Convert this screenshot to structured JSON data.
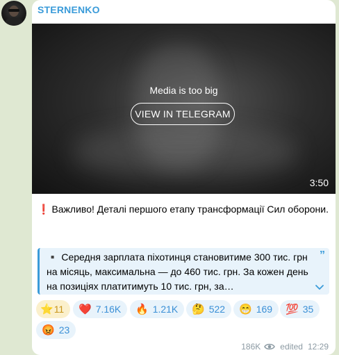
{
  "channel": {
    "name": "STERNENKO"
  },
  "media": {
    "message": "Media is too big",
    "button_label": "VIEW IN TELEGRAM",
    "duration": "3:50"
  },
  "post": {
    "headline_icon": "❗",
    "headline": "Важливо! Деталі першого етапу трансформації Сил оборони.",
    "quote_icon": "▪️",
    "quote_text": "Середня зарплата піхотинця становитиме 300 тис. грн на місяць, максимальна — до 460 тис. грн. За кожен день на позиціях платитимуть 10 тис. грн, за…",
    "quote_mark": "”"
  },
  "reactions": [
    {
      "emoji": "⭐",
      "count": "11",
      "icon": "star-icon"
    },
    {
      "emoji": "❤️",
      "count": "7.16K",
      "icon": "heart-icon"
    },
    {
      "emoji": "🔥",
      "count": "1.21K",
      "icon": "fire-icon"
    },
    {
      "emoji": "🤔",
      "count": "522",
      "icon": "thinking-face-icon"
    },
    {
      "emoji": "😁",
      "count": "169",
      "icon": "grinning-face-icon"
    },
    {
      "emoji": "💯",
      "count": "35",
      "icon": "hundred-points-icon"
    },
    {
      "emoji": "😡",
      "count": "23",
      "icon": "angry-face-icon"
    }
  ],
  "footer": {
    "views": "186K",
    "status": "edited",
    "time": "12:29"
  },
  "colors": {
    "accent": "#3a9bd9",
    "background": "#dfe8d2",
    "bubble": "#ffffff",
    "reaction_bg": "#e8f3fb",
    "star_bg": "#fbf0cc"
  }
}
